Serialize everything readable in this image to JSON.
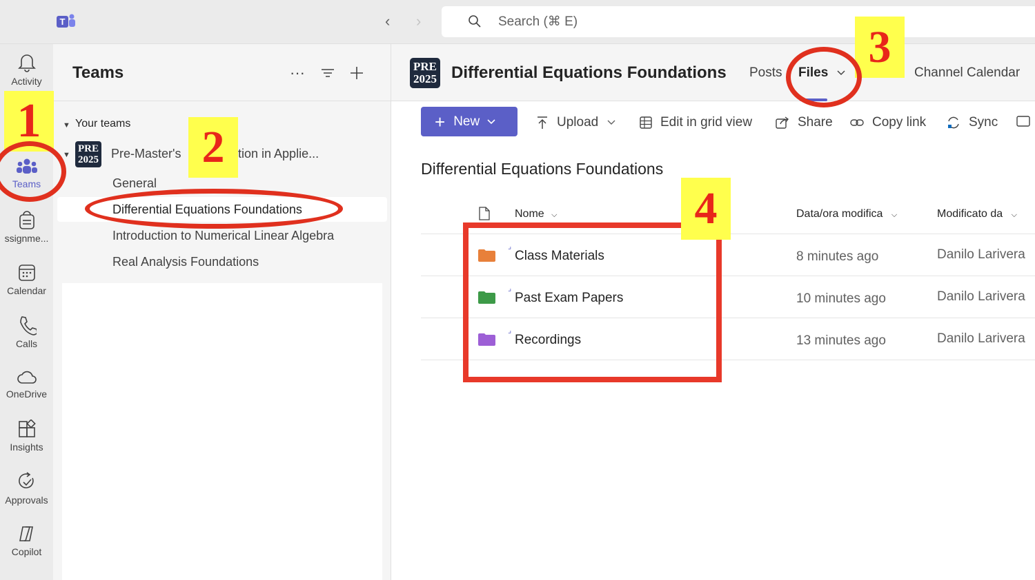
{
  "topbar": {
    "search_placeholder": "Search (⌘ E)",
    "back_glyph": "‹",
    "forward_glyph": "›"
  },
  "rail": {
    "items": [
      {
        "label": "Activity",
        "icon": "bell-icon"
      },
      {
        "label": "Teams",
        "icon": "teams-icon",
        "active": true
      },
      {
        "label": "ssignme...",
        "icon": "assignments-icon"
      },
      {
        "label": "Calendar",
        "icon": "calendar-icon"
      },
      {
        "label": "Calls",
        "icon": "phone-icon"
      },
      {
        "label": "OneDrive",
        "icon": "cloud-icon"
      },
      {
        "label": "Insights",
        "icon": "insights-icon"
      },
      {
        "label": "Approvals",
        "icon": "approvals-icon"
      },
      {
        "label": "Copilot",
        "icon": "copilot-icon"
      }
    ]
  },
  "sidebar": {
    "title": "Teams",
    "more_glyph": "···",
    "section_label": "Your teams",
    "team": {
      "avatar_line1": "PRE",
      "avatar_line2": "2025",
      "name": "Pre-Master's",
      "name_tail": "tion in Applie..."
    },
    "channels": [
      "General",
      "Differential Equations Foundations",
      "Introduction to Numerical Linear Algebra",
      "Real Analysis Foundations"
    ]
  },
  "header": {
    "avatar_line1": "PRE",
    "avatar_line2": "2025",
    "title": "Differential Equations Foundations",
    "tabs": [
      "Posts",
      "Files",
      "Channel Calendar"
    ]
  },
  "toolbar": {
    "new_label": "New",
    "upload_label": "Upload",
    "grid_label": "Edit in grid view",
    "share_label": "Share",
    "copy_link_label": "Copy link",
    "sync_label": "Sync"
  },
  "library": {
    "title": "Differential Equations Foundations",
    "columns": {
      "name": "Nome",
      "modified": "Data/ora modifica",
      "modified_by": "Modificato da"
    },
    "rows": [
      {
        "name": "Class Materials",
        "modified": "8 minutes ago",
        "by": "Danilo Larivera",
        "folder_color": "#e8803a"
      },
      {
        "name": "Past Exam Papers",
        "modified": "10 minutes ago",
        "by": "Danilo Larivera",
        "folder_color": "#3d9a48"
      },
      {
        "name": "Recordings",
        "modified": "13 minutes ago",
        "by": "Danilo Larivera",
        "folder_color": "#9d5fd6"
      }
    ]
  },
  "annotations": {
    "step1": "1",
    "step2": "2",
    "step3": "3",
    "step4": "4"
  },
  "colors": {
    "accent": "#5b5fc7",
    "annotation_red": "#e0301e",
    "annotation_yellow": "#ffff4d"
  }
}
